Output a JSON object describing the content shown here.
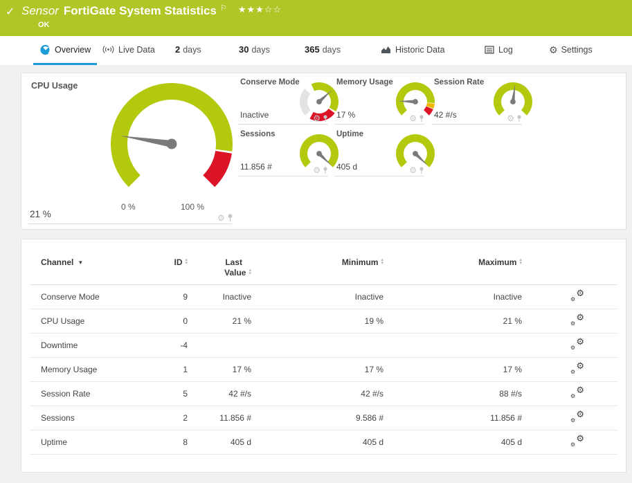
{
  "header": {
    "kind": "Sensor",
    "title": "FortiGate System Statistics",
    "status": "OK"
  },
  "icons": {
    "check": "✓",
    "flag": "⚐",
    "stars": "★★★☆☆",
    "gear": "⚙",
    "channel_sort": "▼",
    "sort_up": "▲",
    "sort_down": "▼"
  },
  "tabs": [
    {
      "label": "Overview",
      "active": true
    },
    {
      "label": "Live Data"
    },
    {
      "prefix": "2",
      "label": "days"
    },
    {
      "prefix": "30",
      "label": "days"
    },
    {
      "prefix": "365",
      "label": "days"
    },
    {
      "label": "Historic Data"
    },
    {
      "label": "Log"
    },
    {
      "label": "Settings"
    }
  ],
  "panels": {
    "cpu": {
      "title": "CPU Usage",
      "value": "21 %",
      "scale_min": "0 %",
      "scale_max": "100 %"
    },
    "small": [
      {
        "key": "conserve",
        "title": "Conserve Mode",
        "value": "Inactive"
      },
      {
        "key": "memory",
        "title": "Memory Usage",
        "value": "17 %"
      },
      {
        "key": "session_rate",
        "title": "Session Rate",
        "value": "42 #/s"
      },
      {
        "key": "sessions",
        "title": "Sessions",
        "value": "11.856 #"
      },
      {
        "key": "uptime",
        "title": "Uptime",
        "value": "405 d"
      }
    ]
  },
  "gauges": {
    "cpu": {
      "size": 178,
      "r_out": 88,
      "r_in": 64,
      "segments": [
        {
          "color": "#b2c90d",
          "from": -135,
          "to": 97
        },
        {
          "color": "#dc1428",
          "from": 99,
          "to": 135
        }
      ],
      "needle_deg": -81,
      "needle_len": 76,
      "needle_w": 5
    },
    "conserve": {
      "size": 58,
      "r_out": 28,
      "r_in": 17,
      "segments": [
        {
          "color": "#e3e3e3",
          "from": -135,
          "to": -48
        },
        {
          "color": "#b2c90d",
          "from": -24,
          "to": 120
        },
        {
          "color": "#dc1428",
          "from": 126,
          "to": 209
        }
      ],
      "needle_deg": 48,
      "needle_len": 25,
      "needle_w": 2.6
    },
    "memory": {
      "size": 58,
      "r_out": 28,
      "r_in": 17,
      "segments": [
        {
          "color": "#b2c90d",
          "from": -135,
          "to": 94
        },
        {
          "color": "#f2b600",
          "from": 96,
          "to": 111
        },
        {
          "color": "#dc1428",
          "from": 113,
          "to": 135
        }
      ],
      "needle_deg": -88,
      "needle_len": 25,
      "needle_w": 2.6
    },
    "session_rate": {
      "size": 58,
      "r_out": 28,
      "r_in": 17,
      "segments": [
        {
          "color": "#b2c90d",
          "from": -135,
          "to": 135
        }
      ],
      "needle_deg": 7,
      "needle_len": 25,
      "needle_w": 2.6
    },
    "sessions": {
      "size": 58,
      "r_out": 28,
      "r_in": 17,
      "segments": [
        {
          "color": "#b2c90d",
          "from": -135,
          "to": 135
        }
      ],
      "needle_deg": 134,
      "needle_len": 25,
      "needle_w": 2.6
    },
    "uptime": {
      "size": 58,
      "r_out": 28,
      "r_in": 17,
      "segments": [
        {
          "color": "#b2c90d",
          "from": -135,
          "to": 135
        }
      ],
      "needle_deg": 134,
      "needle_len": 25,
      "needle_w": 2.6
    }
  },
  "table": {
    "columns": {
      "channel": "Channel",
      "id": "ID",
      "last1": "Last",
      "last2": "Value",
      "min": "Minimum",
      "max": "Maximum"
    },
    "rows": [
      {
        "channel": "Conserve Mode",
        "id": "9",
        "last": "Inactive",
        "min": "Inactive",
        "max": "Inactive"
      },
      {
        "channel": "CPU Usage",
        "id": "0",
        "last": "21 %",
        "min": "19 %",
        "max": "21 %"
      },
      {
        "channel": "Downtime",
        "id": "-4",
        "last": "",
        "min": "",
        "max": ""
      },
      {
        "channel": "Memory Usage",
        "id": "1",
        "last": "17 %",
        "min": "17 %",
        "max": "17 %"
      },
      {
        "channel": "Session Rate",
        "id": "5",
        "last": "42 #/s",
        "min": "42 #/s",
        "max": "88 #/s"
      },
      {
        "channel": "Sessions",
        "id": "2",
        "last": "11.856 #",
        "min": "9.586 #",
        "max": "11.856 #"
      },
      {
        "channel": "Uptime",
        "id": "8",
        "last": "405 d",
        "min": "405 d",
        "max": "405 d"
      }
    ]
  },
  "colors": {
    "brand_green": "#b0c627",
    "gauge_green": "#b2c90d",
    "alert_red": "#dc1428",
    "warn_yellow": "#f2b600",
    "active_blue": "#1e9cd7",
    "needle_gray": "#7a7a7a"
  }
}
